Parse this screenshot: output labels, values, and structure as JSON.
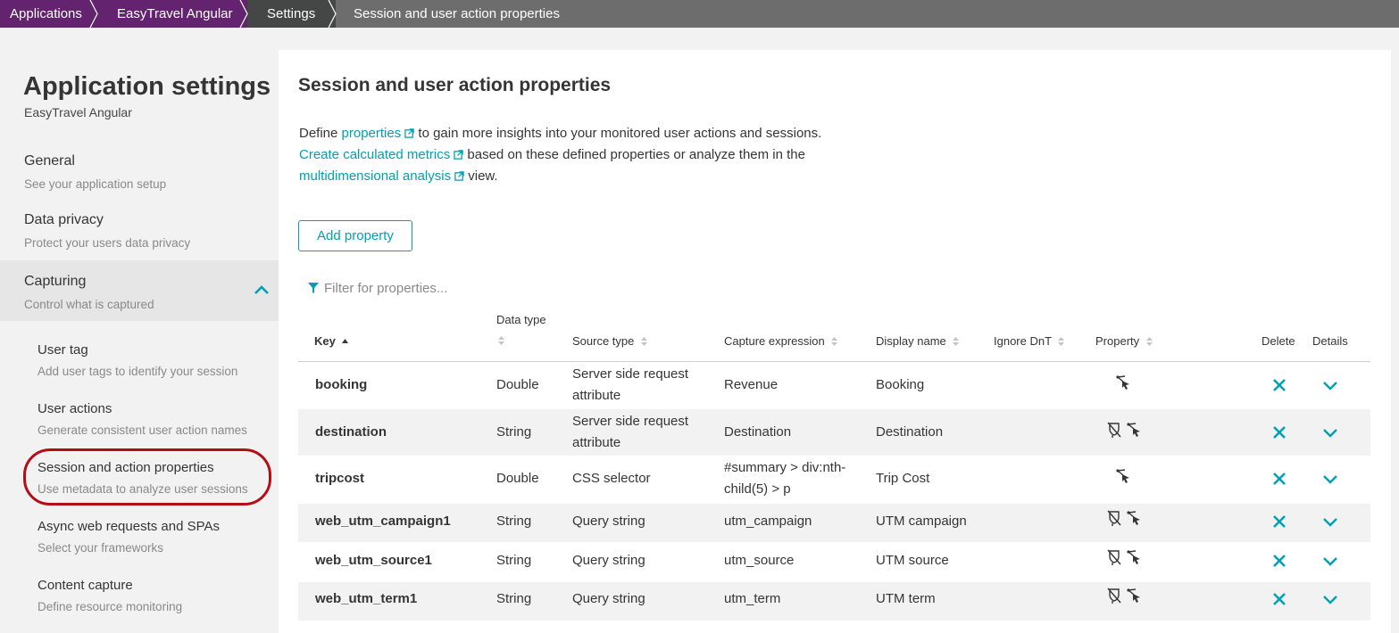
{
  "breadcrumb": [
    "Applications",
    "EasyTravel Angular",
    "Settings",
    "Session and user action properties"
  ],
  "sidebar": {
    "title": "Application settings",
    "subtitle": "EasyTravel Angular",
    "items": [
      {
        "label": "General",
        "desc": "See your application setup"
      },
      {
        "label": "Data privacy",
        "desc": "Protect your users data privacy"
      },
      {
        "label": "Capturing",
        "desc": "Control what is captured"
      }
    ],
    "sub_items": [
      {
        "label": "User tag",
        "desc": "Add user tags to identify your session"
      },
      {
        "label": "User actions",
        "desc": "Generate consistent user action names"
      },
      {
        "label": "Session and action properties",
        "desc": "Use metadata to analyze user sessions"
      },
      {
        "label": "Async web requests and SPAs",
        "desc": "Select your frameworks"
      },
      {
        "label": "Content capture",
        "desc": "Define resource monitoring"
      }
    ]
  },
  "main": {
    "title": "Session and user action properties",
    "intro": {
      "t1": "Define ",
      "link1": "properties",
      "t2": " to gain more insights into your monitored user actions and sessions.",
      "link2": "Create calculated metrics",
      "t3": " based on these defined properties or analyze them in the",
      "link3": "multidimensional analysis",
      "t4": " view."
    },
    "add_button": "Add property",
    "filter_placeholder": "Filter for properties..."
  },
  "table": {
    "headers": {
      "key": "Key",
      "data_type": "Data type",
      "source_type": "Source type",
      "capture_expression": "Capture expression",
      "display_name": "Display name",
      "ignore_dnt": "Ignore DnT",
      "property": "Property",
      "delete": "Delete",
      "details": "Details"
    },
    "rows": [
      {
        "key": "booking",
        "data_type": "Double",
        "source_l1": "Server side request",
        "source_l2": "attribute",
        "expr_l1": "Revenue",
        "expr_l2": "",
        "display": "Booking",
        "icons": [
          "action-property-icon"
        ]
      },
      {
        "key": "destination",
        "data_type": "String",
        "source_l1": "Server side request",
        "source_l2": "attribute",
        "expr_l1": "Destination",
        "expr_l2": "",
        "display": "Destination",
        "icons": [
          "session-property-icon",
          "action-property-icon"
        ]
      },
      {
        "key": "tripcost",
        "data_type": "Double",
        "source_l1": "CSS selector",
        "source_l2": "",
        "expr_l1": "#summary > div:nth-",
        "expr_l2": "child(5) > p",
        "display": "Trip Cost",
        "icons": [
          "action-property-icon"
        ]
      },
      {
        "key": "web_utm_campaign1",
        "data_type": "String",
        "source_l1": "Query string",
        "source_l2": "",
        "expr_l1": "utm_campaign",
        "expr_l2": "",
        "display": "UTM campaign",
        "icons": [
          "session-property-icon",
          "action-property-icon"
        ]
      },
      {
        "key": "web_utm_source1",
        "data_type": "String",
        "source_l1": "Query string",
        "source_l2": "",
        "expr_l1": "utm_source",
        "expr_l2": "",
        "display": "UTM source",
        "icons": [
          "session-property-icon",
          "action-property-icon"
        ]
      },
      {
        "key": "web_utm_term1",
        "data_type": "String",
        "source_l1": "Query string",
        "source_l2": "",
        "expr_l1": "utm_term",
        "expr_l2": "",
        "display": "UTM term",
        "icons": [
          "session-property-icon",
          "action-property-icon"
        ]
      }
    ]
  },
  "colors": {
    "accent": "#00a1b2",
    "breadcrumb_purple": "#63236f",
    "breadcrumb_dark": "#454646",
    "highlight": "#b20e16"
  }
}
